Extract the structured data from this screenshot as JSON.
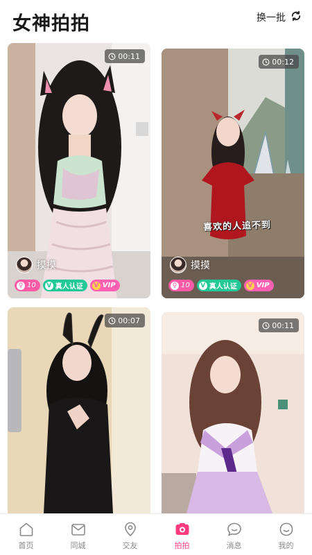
{
  "header": {
    "title": "女神拍拍",
    "refresh_label": "换一批",
    "refresh_icon": "refresh-icon"
  },
  "cards": [
    {
      "duration": "00:11",
      "nickname": "摸摸",
      "gender_level": "10",
      "verified_label": "真人认证",
      "vip_label": "VIP",
      "video_caption": ""
    },
    {
      "duration": "00:12",
      "nickname": "摸摸",
      "gender_level": "10",
      "verified_label": "真人认证",
      "vip_label": "VIP",
      "video_caption": "喜欢的人追不到"
    },
    {
      "duration": "00:07"
    },
    {
      "duration": "00:11"
    }
  ],
  "tabbar": {
    "active": "拍拍",
    "accent_color": "#ff3b7f",
    "items": [
      {
        "label": "首页",
        "icon": "home-icon"
      },
      {
        "label": "同城",
        "icon": "mail-icon"
      },
      {
        "label": "交友",
        "icon": "location-pin-icon"
      },
      {
        "label": "拍拍",
        "icon": "camera-icon"
      },
      {
        "label": "消息",
        "icon": "chat-bubble-icon"
      },
      {
        "label": "我的",
        "icon": "profile-face-icon"
      }
    ]
  }
}
